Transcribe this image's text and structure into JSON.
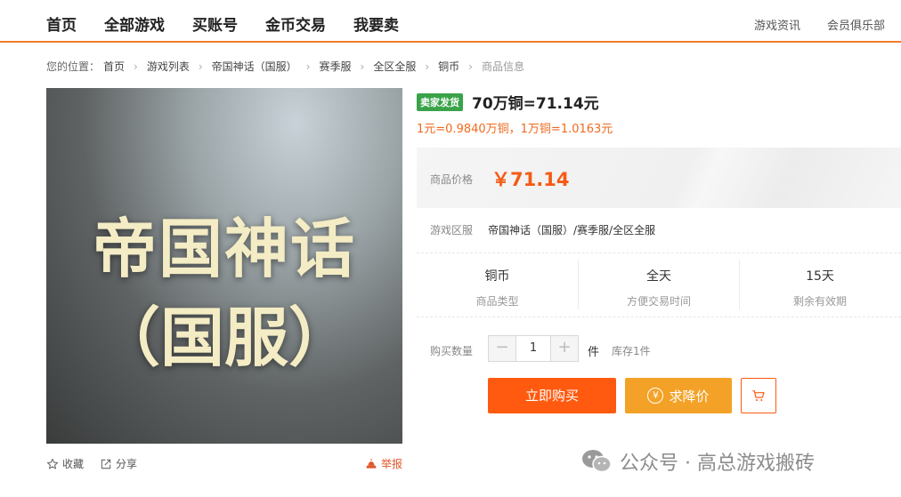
{
  "nav": {
    "main": [
      "首页",
      "全部游戏",
      "买账号",
      "金币交易",
      "我要卖"
    ],
    "right": [
      "游戏资讯",
      "会员俱乐部"
    ]
  },
  "breadcrumb": {
    "prefix": "您的位置：",
    "items": [
      "首页",
      "游戏列表",
      "帝国神话（国服）",
      "赛季服",
      "全区全服",
      "铜币",
      "商品信息"
    ]
  },
  "image": {
    "line1": "帝国神话",
    "line2": "（国服）"
  },
  "image_actions": {
    "favorite": "收藏",
    "share": "分享",
    "report": "举报"
  },
  "product": {
    "seller_badge": "卖家发货",
    "title": "70万铜=71.14元",
    "rate": "1元=0.9840万铜，1万铜=1.0163元",
    "price_label": "商品价格",
    "price": "￥71.14",
    "server_label": "游戏区服",
    "server_value": "帝国神话（国服）/赛季服/全区全服",
    "info": [
      {
        "value": "铜币",
        "key": "商品类型"
      },
      {
        "value": "全天",
        "key": "方便交易时间"
      },
      {
        "value": "15天",
        "key": "剩余有效期"
      }
    ],
    "qty_label": "购买数量",
    "qty_value": "1",
    "qty_unit": "件",
    "stock": "库存1件"
  },
  "buttons": {
    "buy": "立即购买",
    "bargain": "求降价",
    "bargain_icon_glyph": "¥"
  },
  "watermark": "公众号 · 高总游戏搬砖",
  "colors": {
    "accent": "#ff5a0f",
    "bargain": "#f3a227",
    "badge": "#3aa34a",
    "nav_line": "#f07c2a"
  }
}
